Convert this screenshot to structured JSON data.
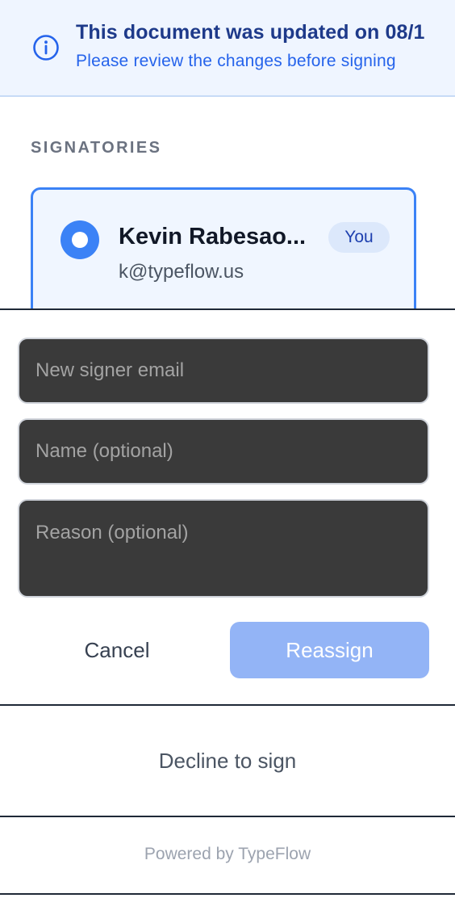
{
  "banner": {
    "icon": "info-icon",
    "title": "This document was updated on 08/1",
    "subtitle": "Please review the changes before signing"
  },
  "signatories": {
    "heading": "SIGNATORIES",
    "items": [
      {
        "name": "Kevin Rabesao...",
        "email": "k@typeflow.us",
        "badge": "You",
        "selected": true
      }
    ]
  },
  "reassign": {
    "email_placeholder": "New signer email",
    "name_placeholder": "Name (optional)",
    "reason_placeholder": "Reason (optional)",
    "cancel_label": "Cancel",
    "submit_label": "Reassign"
  },
  "footer": {
    "decline_label": "Decline to sign",
    "powered_by": "Powered by TypeFlow"
  },
  "colors": {
    "accent": "#3b82f6",
    "banner_bg": "#eff5ff",
    "reassign_disabled": "#93b4f6",
    "field_bg": "#3a3a3a"
  }
}
